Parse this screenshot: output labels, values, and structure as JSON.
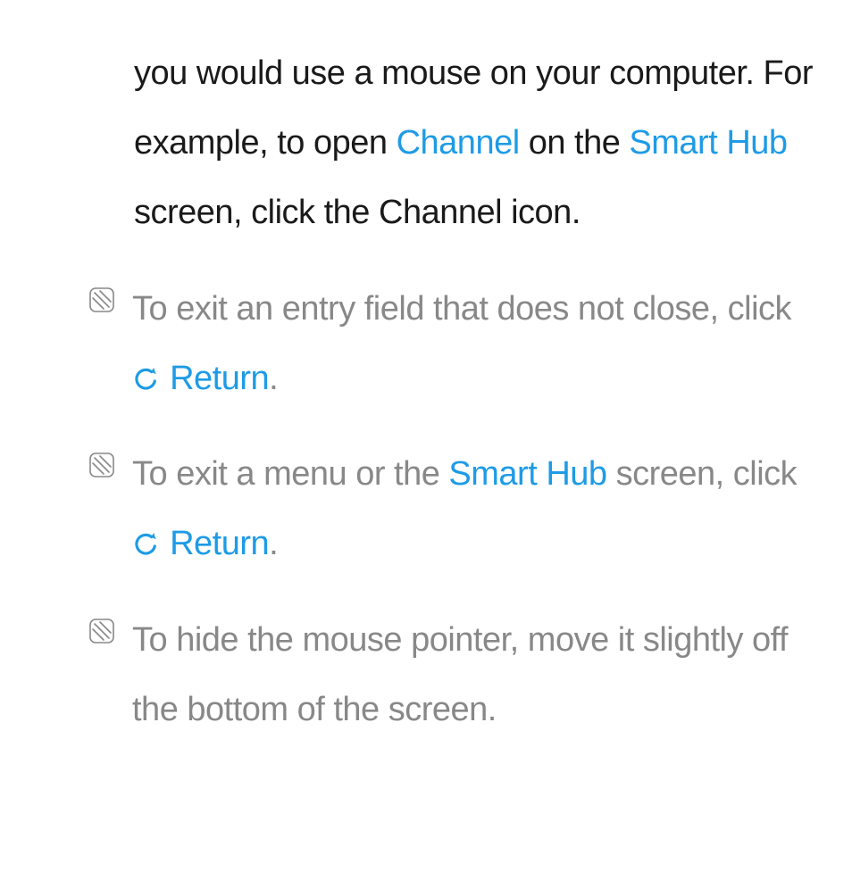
{
  "firstParagraph": {
    "t1": "you would use a mouse on your computer. For example, to open ",
    "link1": "Channel",
    "t2": " on the ",
    "link2": "Smart Hub",
    "t3": " screen, click the Channel icon."
  },
  "notes": [
    {
      "t1": "To exit an entry field that does not close, click ",
      "returnLabel": "Return",
      "t2": "."
    },
    {
      "t1": "To exit a menu or the ",
      "link1": "Smart Hub",
      "t2": " screen, click ",
      "returnLabel": "Return",
      "t3": "."
    },
    {
      "t1": "To hide the mouse pointer, move it slightly off the bottom of the screen."
    }
  ]
}
